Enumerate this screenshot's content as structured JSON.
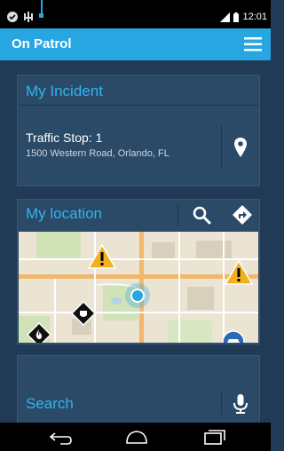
{
  "status_bar": {
    "time": "12:01",
    "icons": [
      "check-circle-icon",
      "usb-icon",
      "signal-icon",
      "battery-icon"
    ]
  },
  "app_bar": {
    "title": "On Patrol",
    "menu_icon": "hamburger-menu-icon"
  },
  "incident": {
    "title": "My Incident",
    "name": "Traffic Stop: 1",
    "address": "1500 Western Road, Orlando, FL",
    "action_icon": "location-pin-icon"
  },
  "location": {
    "title": "My location",
    "actions": [
      "search-icon",
      "directions-icon"
    ],
    "map_markers": [
      "warning-icon",
      "warning-icon",
      "police-badge-icon",
      "fire-icon",
      "current-location-icon",
      "police-car-icon"
    ]
  },
  "search": {
    "title": "Search",
    "action_icon": "microphone-icon"
  },
  "nav_bar": {
    "buttons": [
      "back-icon",
      "home-icon",
      "recent-apps-icon"
    ]
  },
  "colors": {
    "accent": "#28a6e1",
    "card": "#2b4a67",
    "background": "#213a55",
    "title_text": "#2fb4f0"
  }
}
